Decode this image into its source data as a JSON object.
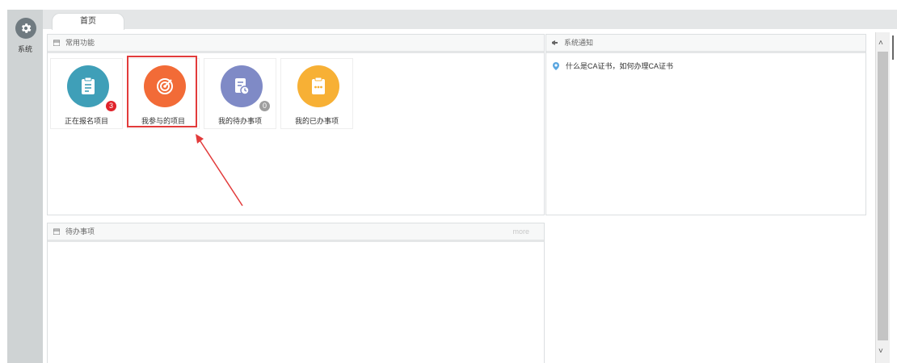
{
  "sidebar": {
    "system_label": "系统",
    "icon": "gear-icon"
  },
  "tabs": [
    {
      "label": "首页"
    }
  ],
  "panels": {
    "common": {
      "title": "常用功能"
    },
    "notice": {
      "title": "系统通知",
      "items": [
        {
          "text": "什么是CA证书，如何办理CA证书"
        }
      ]
    },
    "todo": {
      "title": "待办事项",
      "more": "more"
    }
  },
  "tiles": [
    {
      "label": "正在报名项目",
      "color": "#3f9fb8",
      "icon": "clipboard-icon",
      "badge": "3",
      "badge_color": "#e0232b"
    },
    {
      "label": "我参与的项目",
      "color": "#f26b37",
      "icon": "target-icon"
    },
    {
      "label": "我的待办事项",
      "color": "#7f8ac6",
      "icon": "document-clock-icon",
      "badge": "0",
      "badge_color": "#9e9e9e"
    },
    {
      "label": "我的已办事项",
      "color": "#f7b035",
      "icon": "clipboard-dots-icon"
    }
  ]
}
